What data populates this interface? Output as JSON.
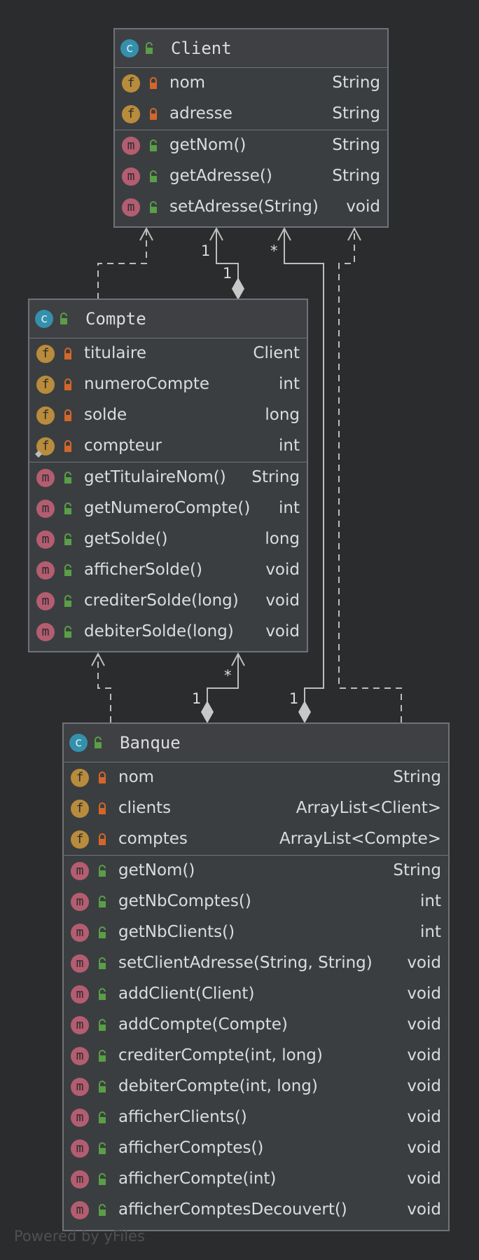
{
  "classes": {
    "client": {
      "name": "Client",
      "badge": "c",
      "fields": [
        {
          "badge": "f",
          "name": "nom",
          "type": "String"
        },
        {
          "badge": "f",
          "name": "adresse",
          "type": "String"
        }
      ],
      "methods": [
        {
          "badge": "m",
          "name": "getNom()",
          "type": "String"
        },
        {
          "badge": "m",
          "name": "getAdresse()",
          "type": "String"
        },
        {
          "badge": "m",
          "name": "setAdresse(String)",
          "type": "void"
        }
      ]
    },
    "compte": {
      "name": "Compte",
      "badge": "c",
      "fields": [
        {
          "badge": "f",
          "name": "titulaire",
          "type": "Client"
        },
        {
          "badge": "f",
          "name": "numeroCompte",
          "type": "int"
        },
        {
          "badge": "f",
          "name": "solde",
          "type": "long"
        },
        {
          "badge": "f",
          "name": "compteur",
          "type": "int"
        }
      ],
      "methods": [
        {
          "badge": "m",
          "name": "getTitulaireNom()",
          "type": "String"
        },
        {
          "badge": "m",
          "name": "getNumeroCompte()",
          "type": "int"
        },
        {
          "badge": "m",
          "name": "getSolde()",
          "type": "long"
        },
        {
          "badge": "m",
          "name": "afficherSolde()",
          "type": "void"
        },
        {
          "badge": "m",
          "name": "crediterSolde(long)",
          "type": "void"
        },
        {
          "badge": "m",
          "name": "debiterSolde(long)",
          "type": "void"
        }
      ]
    },
    "banque": {
      "name": "Banque",
      "badge": "c",
      "fields": [
        {
          "badge": "f",
          "name": "nom",
          "type": "String"
        },
        {
          "badge": "f",
          "name": "clients",
          "type": "ArrayList<Client>"
        },
        {
          "badge": "f",
          "name": "comptes",
          "type": "ArrayList<Compte>"
        }
      ],
      "methods": [
        {
          "badge": "m",
          "name": "getNom()",
          "type": "String"
        },
        {
          "badge": "m",
          "name": "getNbComptes()",
          "type": "int"
        },
        {
          "badge": "m",
          "name": "getNbClients()",
          "type": "int"
        },
        {
          "badge": "m",
          "name": "setClientAdresse(String, String)",
          "type": "void"
        },
        {
          "badge": "m",
          "name": "addClient(Client)",
          "type": "void"
        },
        {
          "badge": "m",
          "name": "addCompte(Compte)",
          "type": "void"
        },
        {
          "badge": "m",
          "name": "crediterCompte(int, long)",
          "type": "void"
        },
        {
          "badge": "m",
          "name": "debiterCompte(int, long)",
          "type": "void"
        },
        {
          "badge": "m",
          "name": "afficherClients()",
          "type": "void"
        },
        {
          "badge": "m",
          "name": "afficherComptes()",
          "type": "void"
        },
        {
          "badge": "m",
          "name": "afficherCompte(int)",
          "type": "void"
        },
        {
          "badge": "m",
          "name": "afficherComptesDecouvert()",
          "type": "void"
        }
      ]
    }
  },
  "multiplicities": {
    "compte_client_target": "1",
    "compte_client_source": "1",
    "banque_client_target": "*",
    "banque_client_source": "1",
    "banque_compte_target": "*",
    "banque_compte_source": "1"
  },
  "colors": {
    "background": "#2b2c2e",
    "box": "#3b3e41",
    "border": "#6f7378",
    "class_badge": "#3590ac",
    "field_badge": "#b88c3c",
    "method_badge": "#b45d71",
    "private_lock": "#d2672a",
    "public_lock": "#5a9e47"
  },
  "watermark": "Powered by yFiles"
}
